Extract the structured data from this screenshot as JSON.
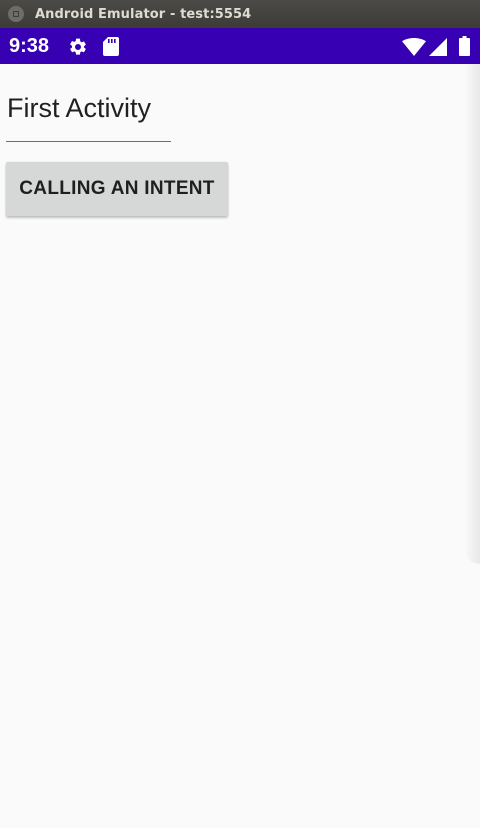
{
  "window": {
    "title": "Android Emulator - test:5554"
  },
  "status_bar": {
    "time": "9:38",
    "background_color": "#3700b3",
    "icons": [
      "gear-icon",
      "sd-card-icon",
      "wifi-icon",
      "cell-signal-icon",
      "battery-icon"
    ]
  },
  "activity": {
    "text_field_value": "First Activity",
    "button_label": "CALLING AN INTENT"
  }
}
